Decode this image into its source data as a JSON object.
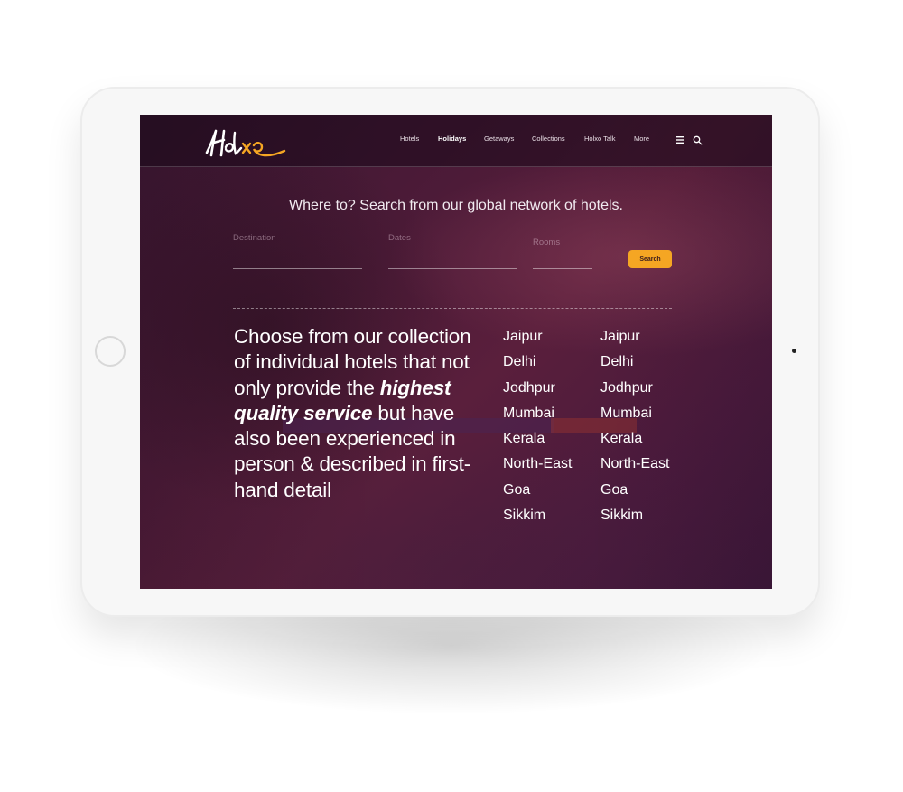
{
  "header": {
    "logo_text": "Holxo",
    "nav": [
      {
        "label": "Hotels",
        "active": false
      },
      {
        "label": "Holidays",
        "active": true
      },
      {
        "label": "Getaways",
        "active": false
      },
      {
        "label": "Collections",
        "active": false
      },
      {
        "label": "Holxo Talk",
        "active": false
      },
      {
        "label": "More",
        "active": false
      }
    ],
    "menu_icon": "hamburger-icon",
    "search_icon": "search-icon"
  },
  "search": {
    "title": "Where to? Search from our global network of hotels.",
    "destination_label": "Destination",
    "dates_label": "Dates",
    "rooms_label": "Rooms",
    "button_label": "Search"
  },
  "tagline": {
    "part1": "Choose from our collection of individual hotels that not only provide the ",
    "emphasis": "highest quality service",
    "part2": " but have also been experienced in person & described in first-hand detail"
  },
  "cities_col1": [
    "Jaipur",
    "Delhi",
    "Jodhpur",
    "Mumbai",
    "Kerala",
    "North-East",
    "Goa",
    "Sikkim"
  ],
  "cities_col2": [
    "Jaipur",
    "Delhi",
    "Jodhpur",
    "Mumbai",
    "Kerala",
    "North-East",
    "Goa",
    "Sikkim"
  ],
  "colors": {
    "accent": "#f5a623",
    "logo_orange": "#f5a623",
    "screen_bg": "#4d1b38",
    "device": "#f7f7f7"
  }
}
